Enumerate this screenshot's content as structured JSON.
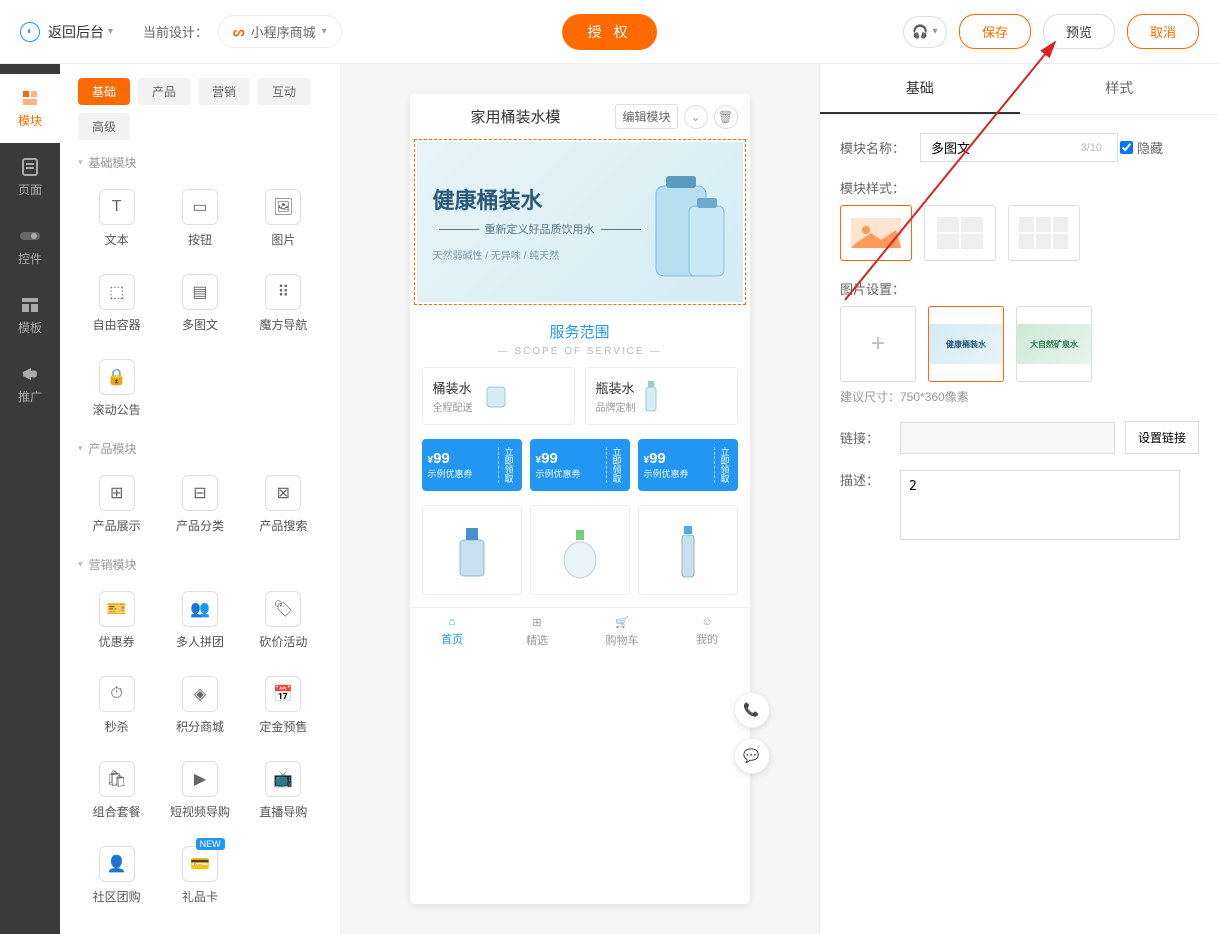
{
  "topbar": {
    "back": "返回后台",
    "cur_design_label": "当前设计：",
    "design_name": "小程序商城",
    "auth_btn": "授 权",
    "save": "保存",
    "preview": "预览",
    "cancel": "取消"
  },
  "rail": [
    {
      "label": "模块"
    },
    {
      "label": "页面"
    },
    {
      "label": "控件"
    },
    {
      "label": "模板"
    },
    {
      "label": "推广"
    }
  ],
  "cat_tabs": [
    "基础",
    "产品",
    "营销",
    "互动",
    "高级"
  ],
  "sections": {
    "basic": {
      "title": "基础模块",
      "items": [
        "文本",
        "按钮",
        "图片",
        "自由容器",
        "多图文",
        "魔方导航",
        "滚动公告"
      ]
    },
    "product": {
      "title": "产品模块",
      "items": [
        "产品展示",
        "产品分类",
        "产品搜索"
      ]
    },
    "marketing": {
      "title": "营销模块",
      "items": [
        "优惠券",
        "多人拼团",
        "砍价活动",
        "秒杀",
        "积分商城",
        "定金预售",
        "组合套餐",
        "短视频导购",
        "直播导购",
        "社区团购",
        "礼品卡"
      ]
    }
  },
  "phone": {
    "title": "家用桶装水模",
    "edit_btn": "编辑模块",
    "banner": {
      "title": "健康桶装水",
      "sub": "重新定义好品质饮用水",
      "tags": "天然弱碱性 / 无异味 / 纯天然"
    },
    "service": {
      "title": "服务范围",
      "sub": "—  SCOPE OF SERVICE  —",
      "cards": [
        {
          "t": "桶装水",
          "s": "全程配送"
        },
        {
          "t": "瓶装水",
          "s": "品牌定制"
        }
      ]
    },
    "coupons": [
      {
        "price": "99",
        "desc": "示例优惠券",
        "action": "立即领取"
      },
      {
        "price": "99",
        "desc": "示例优惠券",
        "action": "立即领取"
      },
      {
        "price": "99",
        "desc": "示例优惠券",
        "action": "立即领取"
      }
    ],
    "tabs": [
      "首页",
      "精选",
      "购物车",
      "我的"
    ]
  },
  "right": {
    "tabs": [
      "基础",
      "样式"
    ],
    "name_label": "模块名称：",
    "name_value": "多图文",
    "name_count": "3/10",
    "hide_label": "隐藏",
    "style_label": "模块样式：",
    "img_label": "图片设置：",
    "img_hint": "建议尺寸：750*360像素",
    "link_label": "链接：",
    "link_btn": "设置链接",
    "desc_label": "描述：",
    "desc_value": "2",
    "new_badge": "NEW"
  }
}
